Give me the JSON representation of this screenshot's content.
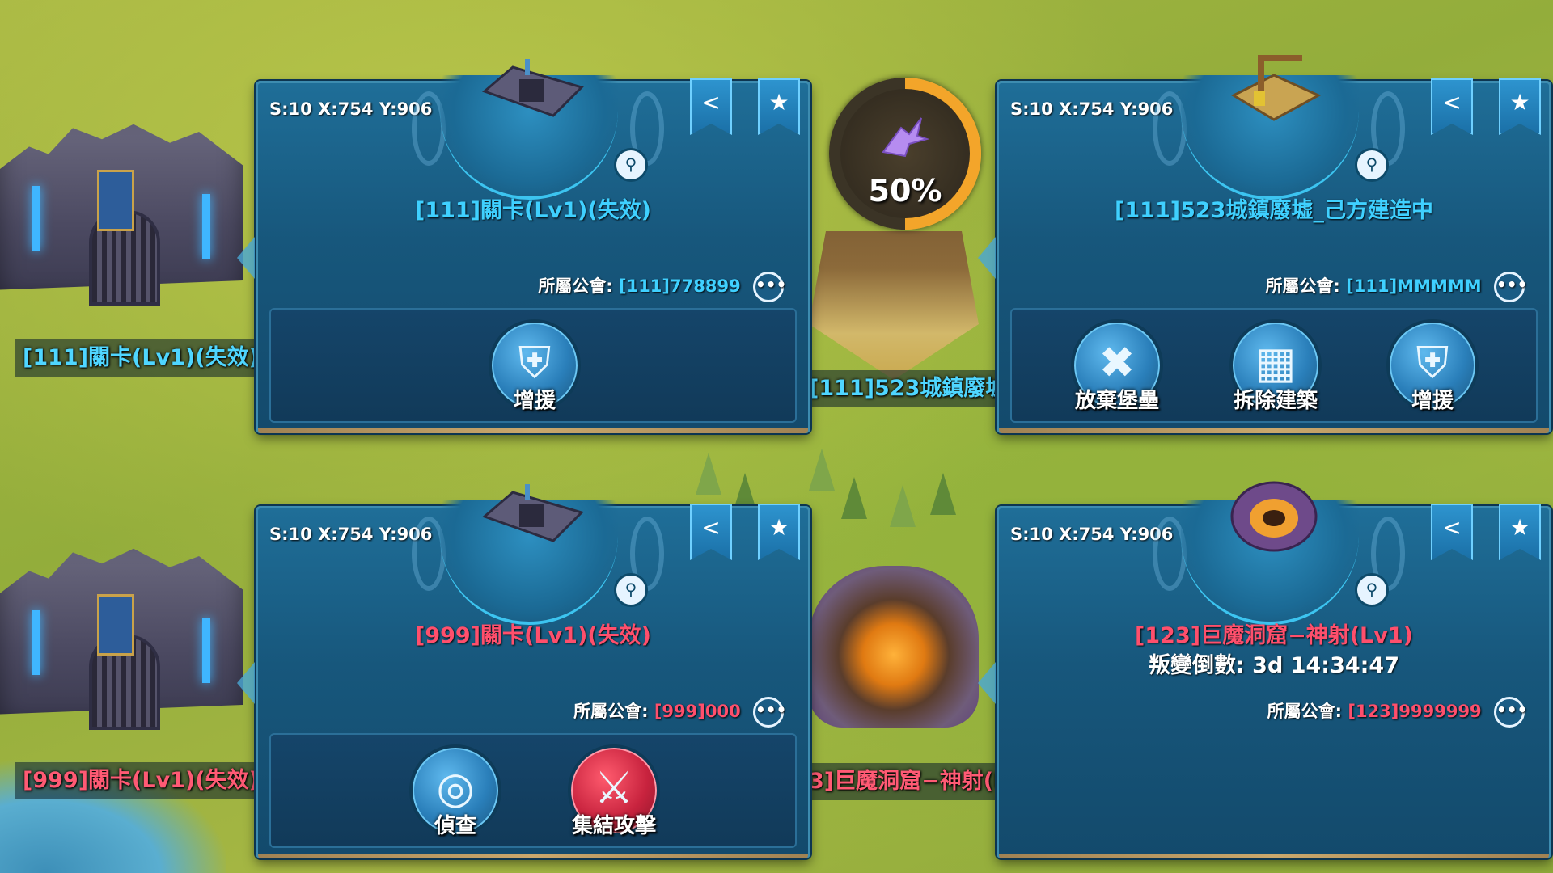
{
  "map": {
    "labels": [
      {
        "text": "[111]關卡(Lv1)(失效)",
        "color": "#4fd6ff"
      },
      {
        "text": "[111]523城鎮廢墟",
        "color": "#4fd6ff"
      },
      {
        "text": "[999]關卡(Lv1)(失效)",
        "color": "#ff5a74"
      },
      {
        "text": "3]巨魔洞窟−神射(L",
        "color": "#ff5a74"
      }
    ],
    "construction_progress": {
      "value": 0.5,
      "text": "50%",
      "icon": "pegasus-icon"
    }
  },
  "panels": [
    {
      "coords": "S:10 X:754 Y:906",
      "title": "[111]關卡(Lv1)(失效)",
      "title_color": "#3fd0ff",
      "guild_label": "所屬公會:",
      "guild_value": "[111]778899",
      "actions": [
        {
          "label": "增援",
          "icon": "shield-plus-icon"
        }
      ]
    },
    {
      "coords": "S:10 X:754 Y:906",
      "title": "[111]523城鎮廢墟_己方建造中",
      "title_color": "#3fd0ff",
      "guild_label": "所屬公會:",
      "guild_value": "[111]MMMMM",
      "actions": [
        {
          "label": "放棄堡壘",
          "icon": "abandon-fortress-icon"
        },
        {
          "label": "拆除建築",
          "icon": "demolish-icon"
        },
        {
          "label": "增援",
          "icon": "shield-plus-icon"
        }
      ]
    },
    {
      "coords": "S:10 X:754 Y:906",
      "title": "[999]關卡(Lv1)(失效)",
      "title_color": "#ff4f6c",
      "guild_label": "所屬公會:",
      "guild_value": "[999]000",
      "actions": [
        {
          "label": "偵查",
          "icon": "binoculars-icon"
        },
        {
          "label": "集結攻擊",
          "icon": "crossed-swords-icon"
        }
      ]
    },
    {
      "coords": "S:10 X:754 Y:906",
      "title": "[123]巨魔洞窟−神射(Lv1)",
      "title_color": "#ff4f6c",
      "countdown": "叛變倒數: 3d 14:34:47",
      "guild_label": "所屬公會:",
      "guild_value": "[123]9999999",
      "actions": []
    }
  ],
  "icons": {
    "share": "share-icon",
    "favorite": "star-icon",
    "magnify": "magnify-icon",
    "more": "more-options-icon"
  }
}
